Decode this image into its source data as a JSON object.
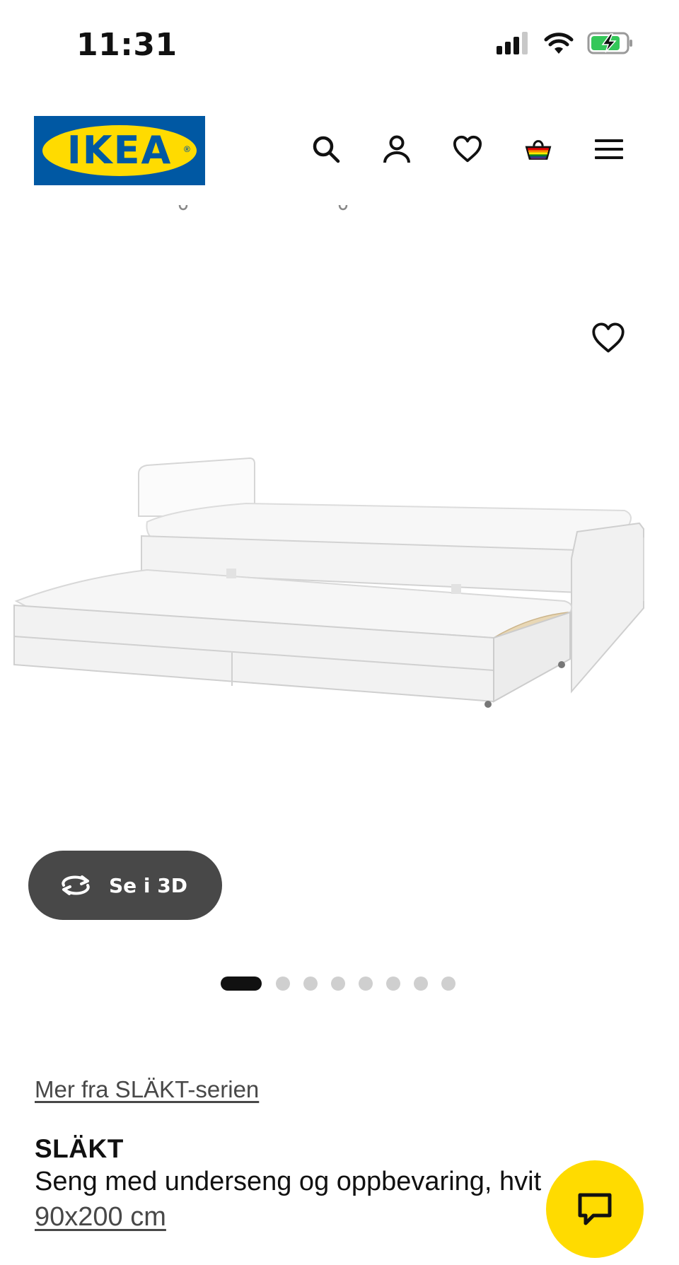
{
  "status_bar": {
    "time": "11:31"
  },
  "header": {
    "logo_text": "IKEA",
    "brand_colors": {
      "blue": "#0058a3",
      "yellow": "#ffdb00"
    },
    "icons": [
      "search-icon",
      "account-icon",
      "heart-icon",
      "basket-icon",
      "menu-icon"
    ]
  },
  "gallery": {
    "view_3d_label": "Se i 3D",
    "slide_count": 8,
    "active_slide": 1
  },
  "product": {
    "series_link": "Mer fra SLÄKT-serien",
    "name": "SLÄKT",
    "description": "Seng med underseng og oppbevaring, hvit",
    "size": "90x200 cm"
  },
  "chat": {
    "icon": "chat-icon",
    "color": "#ffdb00"
  }
}
